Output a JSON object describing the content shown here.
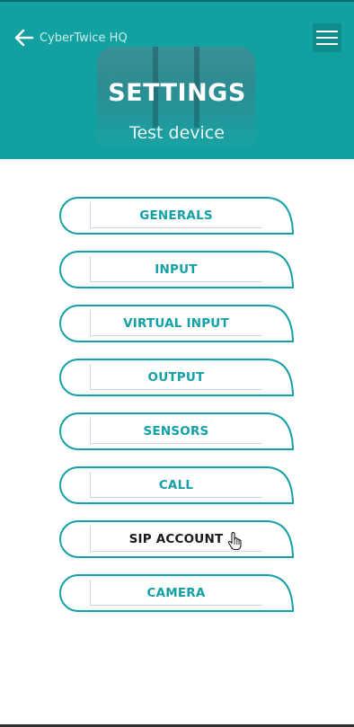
{
  "header": {
    "back_label": "CyberTwice HQ",
    "title": "SETTINGS",
    "subtitle": "Test device",
    "back_icon": "arrow-left-icon",
    "menu_icon": "hamburger-menu-icon",
    "background_color": "#12a0a0"
  },
  "menu": {
    "items": [
      {
        "label": "GENERALS"
      },
      {
        "label": "INPUT"
      },
      {
        "label": "VIRTUAL INPUT"
      },
      {
        "label": "OUTPUT"
      },
      {
        "label": "SENSORS"
      },
      {
        "label": "CALL"
      },
      {
        "label": "SIP ACCOUNT"
      },
      {
        "label": "CAMERA"
      }
    ],
    "accent_color": "#13a0a6",
    "hovered_item": "SIP ACCOUNT"
  }
}
